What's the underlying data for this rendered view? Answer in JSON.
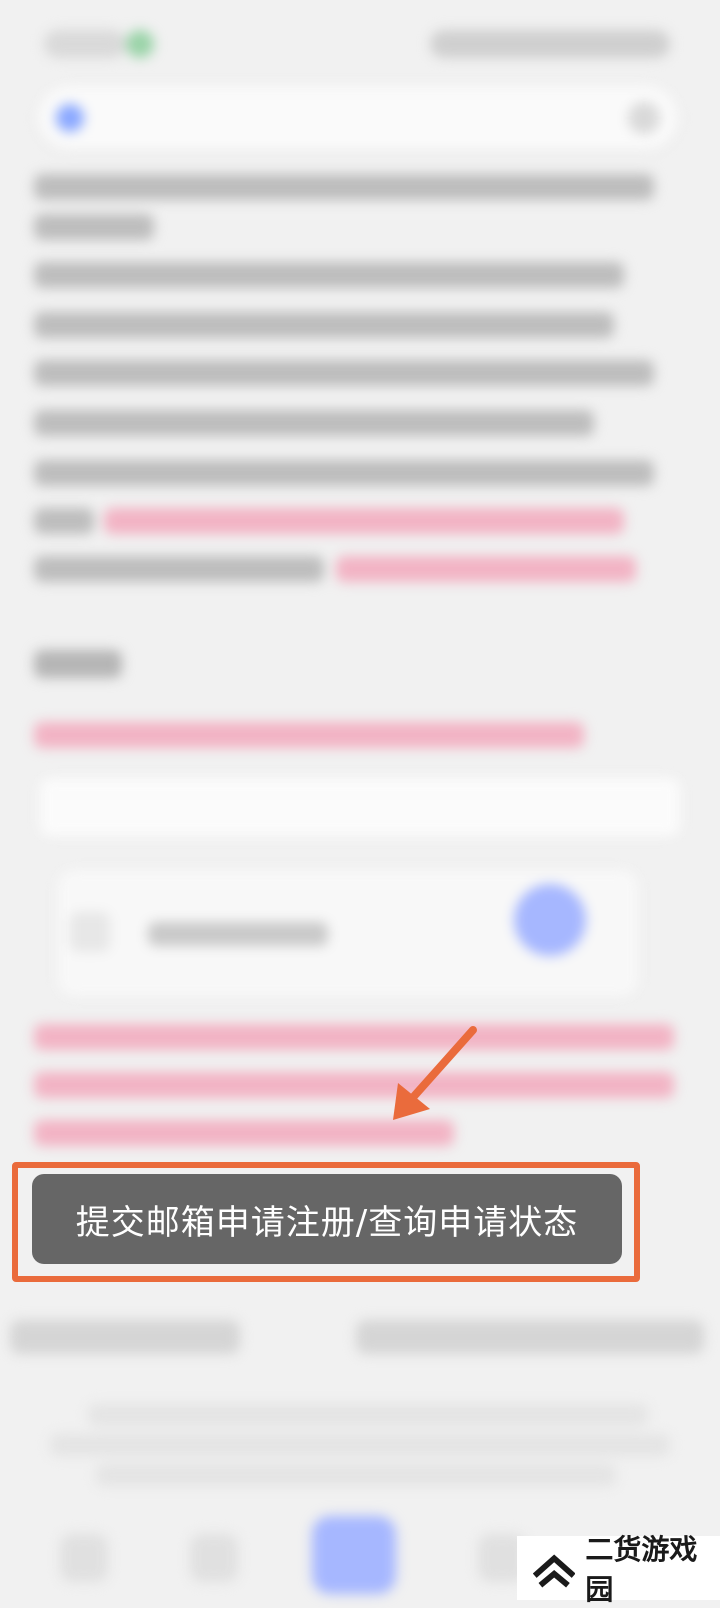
{
  "button": {
    "label": "提交邮箱申请注册/查询申请状态"
  },
  "watermark": {
    "text": "二货游戏园"
  },
  "colors": {
    "highlight": "#ea6b3c",
    "button_bg": "#666666",
    "background": "#f1f1f1"
  },
  "icons": {
    "arrow": "arrow-down-left-icon",
    "watermark_logo": "chevron-up-logo-icon"
  }
}
